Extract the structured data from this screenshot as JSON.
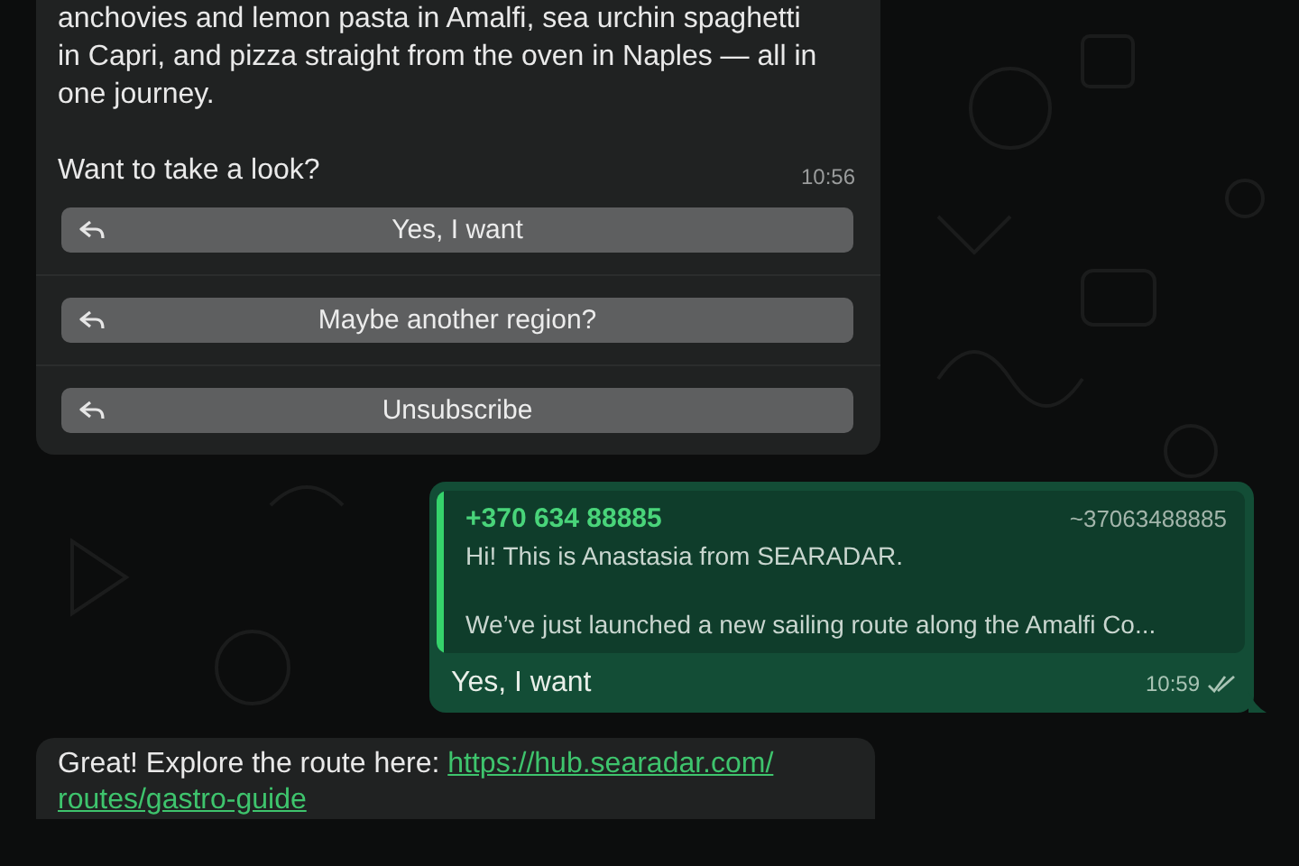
{
  "messages": [
    {
      "kind": "incoming",
      "paragraphs": [
        [
          "anchovies and lemon pasta in Amalfi, sea urchin spaghetti",
          "in Capri, and pizza straight from the oven in Naples — all in",
          "one journey."
        ],
        [
          "Want to take a look?"
        ]
      ],
      "time": "10:56",
      "buttons": [
        "Yes, I want",
        "Maybe another region?",
        "Unsubscribe"
      ]
    },
    {
      "kind": "outgoing",
      "quote": {
        "author": "+370 634 88885",
        "handle": "~37063488885",
        "lines": [
          "Hi! This is Anastasia from SEARADAR.",
          "We’ve just launched a new sailing route along the Amalfi Co..."
        ]
      },
      "text": "Yes, I want",
      "time": "10:59",
      "read": false
    },
    {
      "kind": "incoming",
      "text": "Great! Explore the route here:",
      "link": [
        "https://hub.searadar.com/",
        "routes/gastro-guide"
      ]
    }
  ]
}
